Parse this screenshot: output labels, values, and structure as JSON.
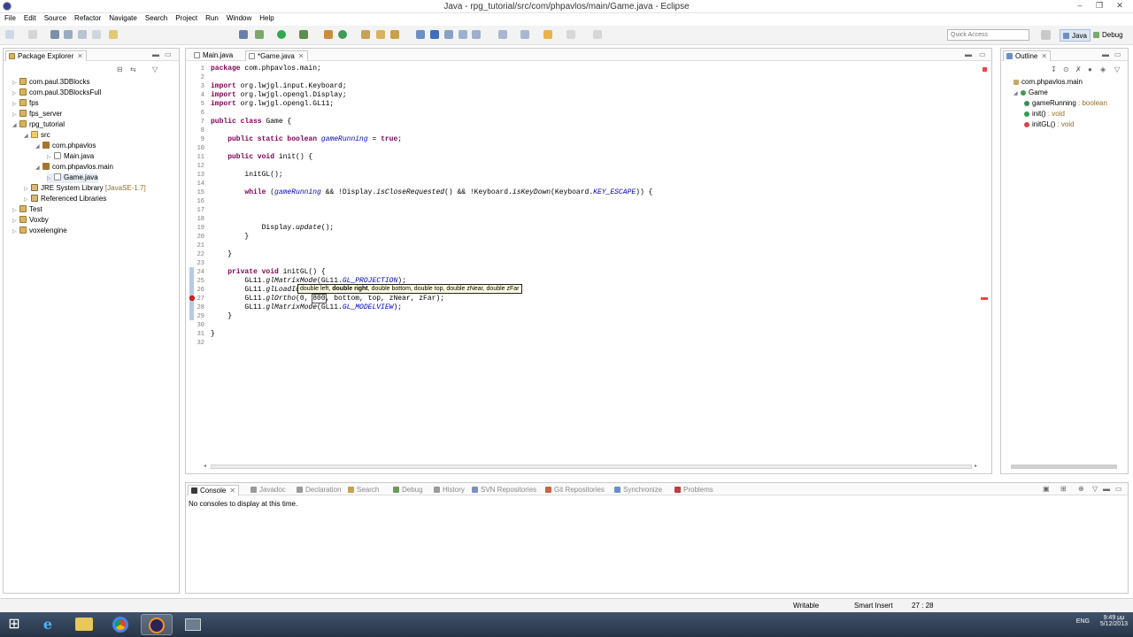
{
  "window": {
    "title": "Java - rpg_tutorial/src/com/phpavlos/main/Game.java - Eclipse",
    "minimize": "–",
    "maximize": "❐",
    "close": "✕"
  },
  "menus": [
    "File",
    "Edit",
    "Source",
    "Refactor",
    "Navigate",
    "Search",
    "Project",
    "Run",
    "Window",
    "Help"
  ],
  "toolbar": {
    "quick_access": "Quick Access",
    "perspectives": [
      "Java",
      "Debug"
    ]
  },
  "package_explorer": {
    "title": "Package Explorer",
    "items": [
      {
        "label": "com.paul.3DBlocks",
        "depth": 0,
        "icon": "project",
        "twisty": "▷"
      },
      {
        "label": "com.paul.3DBlocksFull",
        "depth": 0,
        "icon": "project",
        "twisty": "▷"
      },
      {
        "label": "fps",
        "depth": 0,
        "icon": "project",
        "twisty": "▷"
      },
      {
        "label": "fps_server",
        "depth": 0,
        "icon": "project",
        "twisty": "▷"
      },
      {
        "label": "rpg_tutorial",
        "depth": 0,
        "icon": "project",
        "twisty": "◢"
      },
      {
        "label": "src",
        "depth": 1,
        "icon": "source-folder",
        "twisty": "◢"
      },
      {
        "label": "com.phpavlos",
        "depth": 2,
        "icon": "package",
        "twisty": "◢"
      },
      {
        "label": "Main.java",
        "depth": 3,
        "icon": "java-file",
        "twisty": "▷"
      },
      {
        "label": "com.phpavlos.main",
        "depth": 2,
        "icon": "package",
        "twisty": "◢"
      },
      {
        "label": "Game.java",
        "depth": 3,
        "icon": "java-file",
        "twisty": "▷",
        "selected": true
      },
      {
        "label": "JRE System Library",
        "suffix": " [JavaSE-1.7]",
        "depth": 1,
        "icon": "library",
        "twisty": "▷"
      },
      {
        "label": "Referenced Libraries",
        "depth": 1,
        "icon": "library",
        "twisty": "▷"
      },
      {
        "label": "Test",
        "depth": 0,
        "icon": "project",
        "twisty": "▷"
      },
      {
        "label": "Voxby",
        "depth": 0,
        "icon": "project",
        "twisty": "▷"
      },
      {
        "label": "voxelengine",
        "depth": 0,
        "icon": "project",
        "twisty": "▷"
      }
    ]
  },
  "editor": {
    "tabs": [
      {
        "label": "Main.java",
        "active": false
      },
      {
        "label": "*Game.java",
        "active": true,
        "close": "✕"
      }
    ],
    "lines": [
      {
        "n": "1",
        "html": "<span class=\"kw\">package</span> com.phpavlos.main;"
      },
      {
        "n": "2",
        "html": ""
      },
      {
        "n": "3",
        "html": "<span class=\"kw\">import</span> org.lwjgl.input.Keyboard;"
      },
      {
        "n": "4",
        "html": "<span class=\"kw\">import</span> org.lwjgl.opengl.Display;"
      },
      {
        "n": "5",
        "html": "<span class=\"kw\">import</span> org.lwjgl.opengl.GL11;"
      },
      {
        "n": "6",
        "html": ""
      },
      {
        "n": "7",
        "html": "<span class=\"kw\">public class</span> Game {"
      },
      {
        "n": "8",
        "html": ""
      },
      {
        "n": "9",
        "html": "    <span class=\"kw\">public static boolean</span> <span class=\"fld\">gameRunning</span> = <span class=\"kw\">true</span>;"
      },
      {
        "n": "10",
        "html": ""
      },
      {
        "n": "11",
        "html": "    <span class=\"kw\">public void</span> init() {"
      },
      {
        "n": "12",
        "html": ""
      },
      {
        "n": "13",
        "html": "        initGL();"
      },
      {
        "n": "14",
        "html": ""
      },
      {
        "n": "15",
        "html": "        <span class=\"kw\">while</span> (<span class=\"fld\">gameRunning</span> &amp;&amp; !Display.<span class=\"st\">isCloseRequested</span>() &amp;&amp; !Keyboard.<span class=\"st\">isKeyDown</span>(Keyboard.<span class=\"cst\">KEY_ESCAPE</span>)) {"
      },
      {
        "n": "16",
        "html": ""
      },
      {
        "n": "17",
        "html": ""
      },
      {
        "n": "18",
        "html": ""
      },
      {
        "n": "19",
        "html": "            Display.<span class=\"st\">update</span>();"
      },
      {
        "n": "20",
        "html": "        }"
      },
      {
        "n": "21",
        "html": ""
      },
      {
        "n": "22",
        "html": "    }"
      },
      {
        "n": "23",
        "html": ""
      },
      {
        "n": "24",
        "html": "    <span class=\"kw\">private void</span> initGL() {"
      },
      {
        "n": "25",
        "html": "        GL11.<span class=\"st\">glMatrixMode</span>(GL11.<span class=\"cst\">GL_PROJECTION</span>);"
      },
      {
        "n": "26",
        "html": "        GL11.<span class=\"st\">glLoadId</span>"
      },
      {
        "n": "27",
        "html": "        GL11.<span class=\"st\">glOrtho</span>(0, <span style=\"outline:1px solid #555\">800</span>, bottom, top, zNear, zFar);"
      },
      {
        "n": "28",
        "html": "        GL11.<span class=\"st\">glMatrixMode</span>(GL11.<span class=\"cst\">GL_MODELVIEW</span>);"
      },
      {
        "n": "29",
        "html": "    }"
      },
      {
        "n": "30",
        "html": ""
      },
      {
        "n": "31",
        "html": "}"
      },
      {
        "n": "32",
        "html": ""
      }
    ],
    "param_hint": {
      "before": "double left, ",
      "bold": "double right",
      "after": ", double bottom, double top, double zNear, double zFar"
    }
  },
  "outline": {
    "title": "Outline",
    "items": [
      {
        "label": "com.phpavlos.main",
        "depth": 0,
        "icon": "package-decl"
      },
      {
        "label": "Game",
        "depth": 0,
        "icon": "class",
        "twisty": "◢"
      },
      {
        "label": "gameRunning",
        "suffix": " : boolean",
        "depth": 1,
        "icon": "static-field"
      },
      {
        "label": "init()",
        "suffix": " : void",
        "depth": 1,
        "icon": "public-method"
      },
      {
        "label": "initGL()",
        "suffix": " : void",
        "depth": 1,
        "icon": "private-method"
      }
    ]
  },
  "bottom_panel": {
    "tabs": [
      "Console",
      "Javadoc",
      "Declaration",
      "Search",
      "Debug",
      "History",
      "SVN Repositories",
      "Git Repositories",
      "Synchronize",
      "Problems"
    ],
    "message": "No consoles to display at this time."
  },
  "status": {
    "writable": "Writable",
    "insert_mode": "Smart Insert",
    "position": "27 : 28"
  },
  "taskbar": {
    "lang": "ENG",
    "time": "9:49 μμ",
    "date": "5/12/2013"
  },
  "colors": {
    "keyword": "#7f0055",
    "field": "#0000c0",
    "error": "#e22222",
    "selection": "#c8d8f0"
  }
}
